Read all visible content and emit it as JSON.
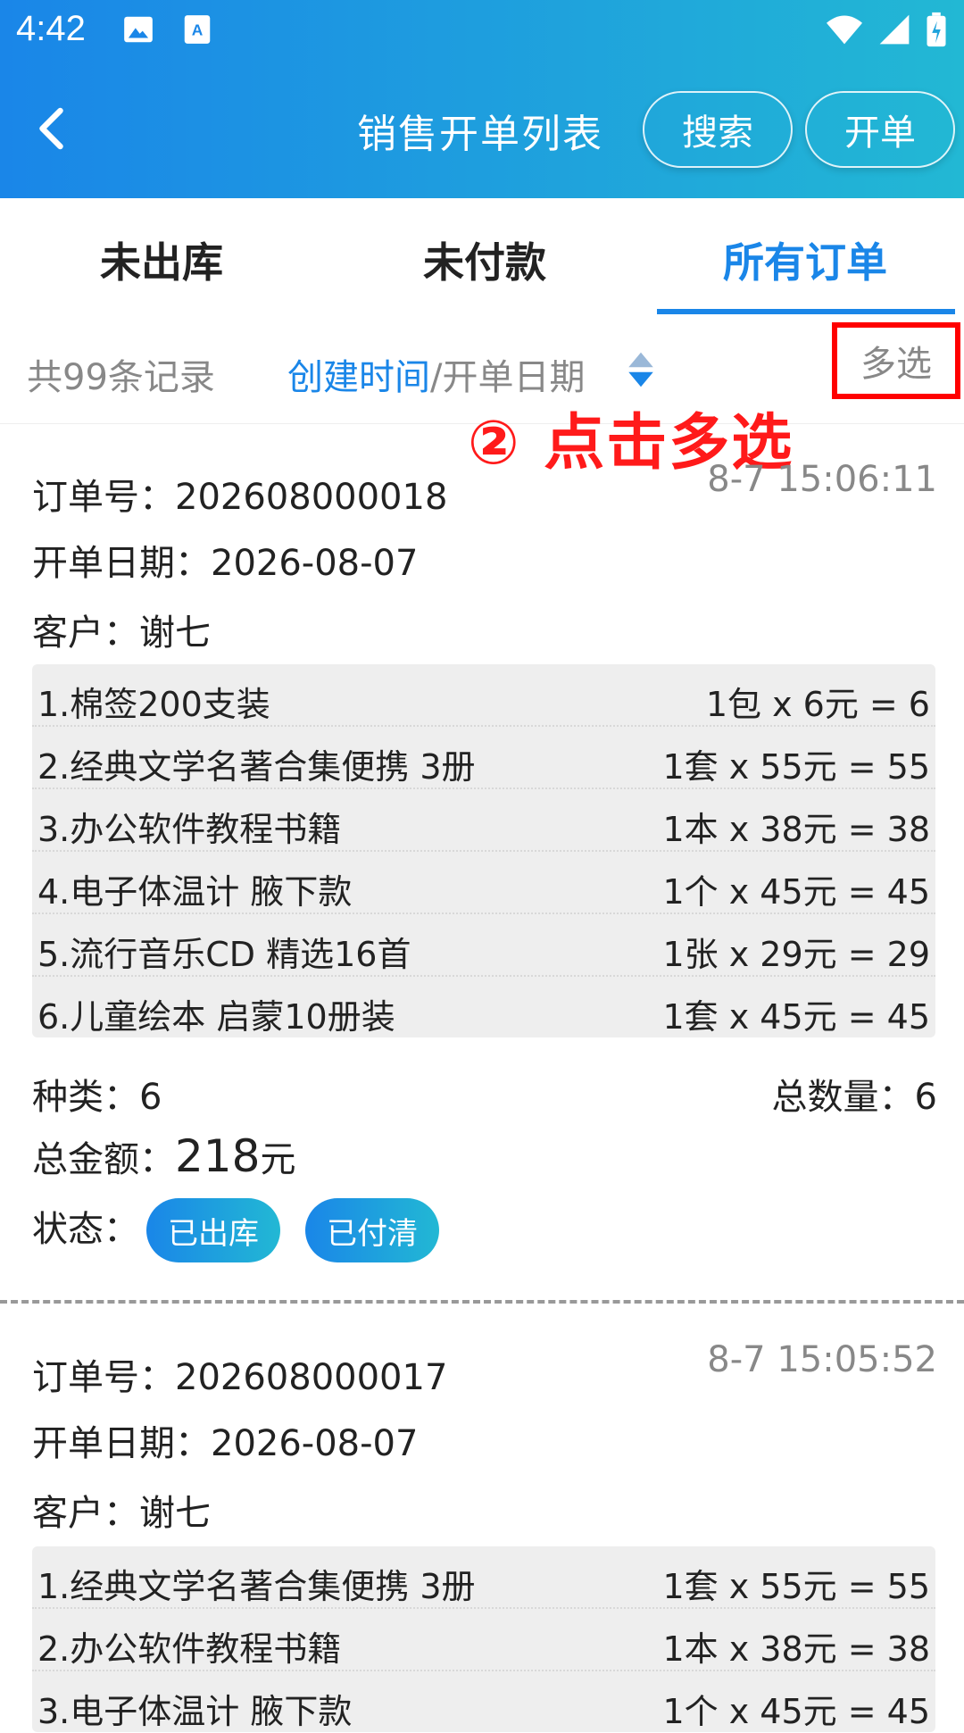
{
  "status_bar": {
    "time": "4:42"
  },
  "header": {
    "title": "销售开单列表",
    "search_label": "搜索",
    "new_label": "开单"
  },
  "tabs": [
    {
      "label": "未出库"
    },
    {
      "label": "未付款"
    },
    {
      "label": "所有订单",
      "active": true
    }
  ],
  "filter": {
    "record_count": "共99条记录",
    "sort_active": "创建时间",
    "sort_sep": "/",
    "sort_other": "开单日期",
    "multi_select": "多选"
  },
  "annotation": "② 点击多选",
  "orders": [
    {
      "order_no": "订单号：202608000018",
      "time": "8-7 15:06:11",
      "date": "开单日期：2026-08-07",
      "customer": "客户：谢七",
      "items": [
        {
          "name": "1.棉签200支装",
          "price": "1包 x 6元 = 6"
        },
        {
          "name": "2.经典文学名著合集便携 3册",
          "price": "1套 x 55元 = 55"
        },
        {
          "name": "3.办公软件教程书籍",
          "price": "1本 x 38元 = 38"
        },
        {
          "name": "4.电子体温计 腋下款",
          "price": "1个 x 45元 = 45"
        },
        {
          "name": "5.流行音乐CD 精选16首",
          "price": "1张 x 29元 = 29"
        },
        {
          "name": "6.儿童绘本 启蒙10册装",
          "price": "1套 x 45元 = 45"
        }
      ],
      "kinds": "种类：6",
      "total_qty": "总数量：6",
      "amount_label": "总金额：",
      "amount_value": "218",
      "amount_unit": "元",
      "status_label": "状态：",
      "badges": [
        "已出库",
        "已付清"
      ]
    },
    {
      "order_no": "订单号：202608000017",
      "time": "8-7 15:05:52",
      "date": "开单日期：2026-08-07",
      "customer": "客户：谢七",
      "items": [
        {
          "name": "1.经典文学名著合集便携 3册",
          "price": "1套 x 55元 = 55"
        },
        {
          "name": "2.办公软件教程书籍",
          "price": "1本 x 38元 = 38"
        },
        {
          "name": "3.电子体温计 腋下款",
          "price": "1个 x 45元 = 45"
        }
      ]
    }
  ],
  "colors": {
    "accent": "#1a86e8",
    "annotation": "#ff0000"
  }
}
